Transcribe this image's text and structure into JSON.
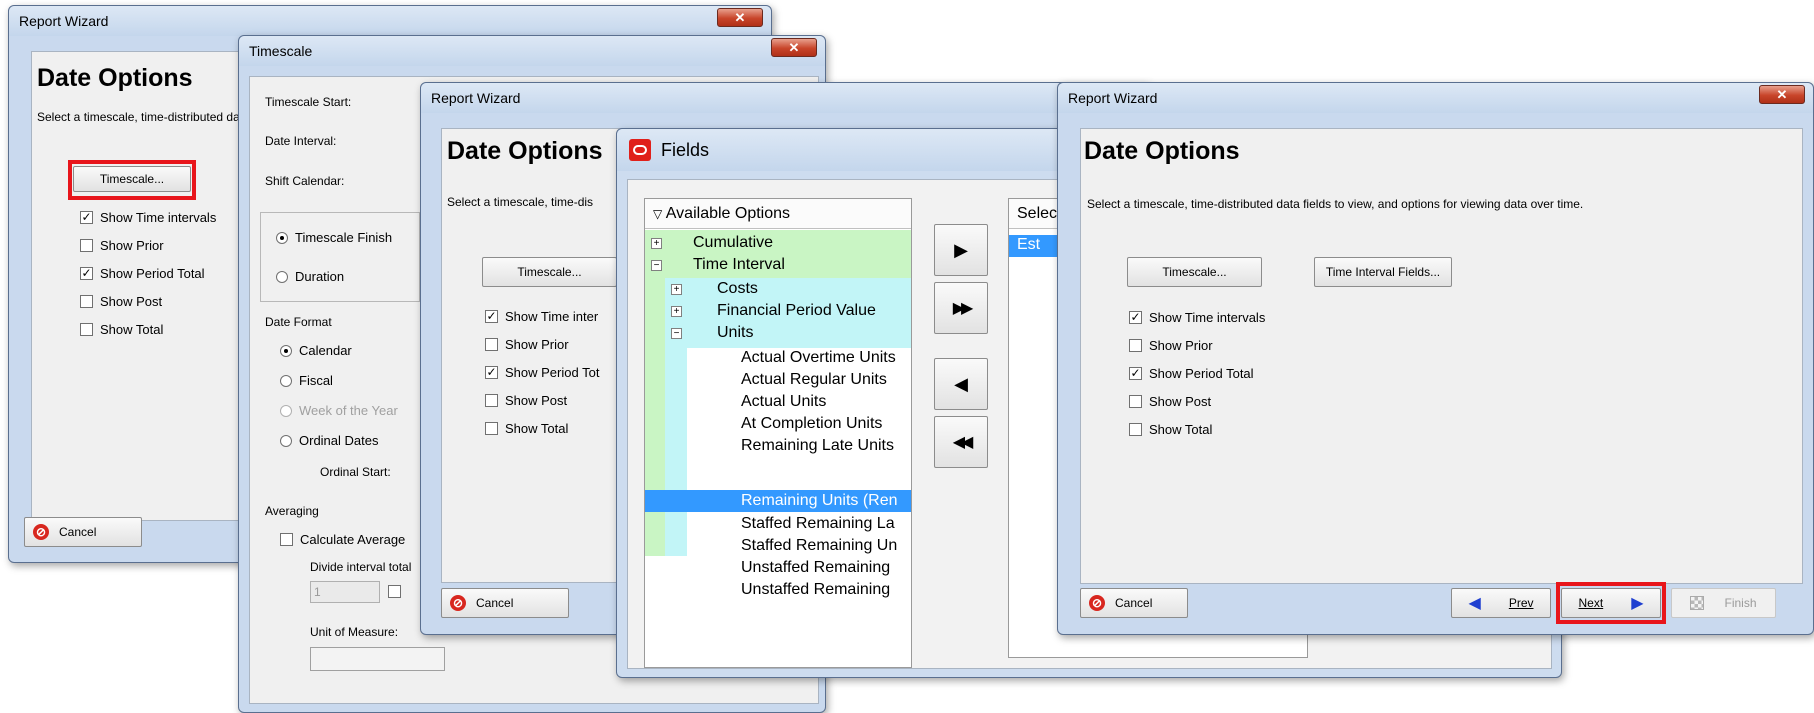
{
  "win1": {
    "title": "Report Wizard",
    "heading": "Date Options",
    "description": "Select a timescale, time-distributed data fields to view, and options for viewing data over time.",
    "timescale_btn": "Timescale...",
    "checkboxes": [
      {
        "label": "Show Time intervals",
        "checked": true
      },
      {
        "label": "Show Prior",
        "checked": false
      },
      {
        "label": "Show Period Total",
        "checked": true
      },
      {
        "label": "Show Post",
        "checked": false
      },
      {
        "label": "Show Total",
        "checked": false
      }
    ],
    "cancel": "Cancel"
  },
  "timescale": {
    "title": "Timescale",
    "start_label": "Timescale Start:",
    "interval_label": "Date Interval:",
    "shift_label": "Shift Calendar:",
    "finish_radio": "Timescale Finish",
    "duration_radio": "Duration",
    "date_format_label": "Date Format",
    "calendar": "Calendar",
    "fiscal": "Fiscal",
    "week": "Week of the Year",
    "ordinal": "Ordinal Dates",
    "ordinal_start": "Ordinal Start:",
    "averaging_label": "Averaging",
    "calc_avg": "Calculate Average",
    "divide_label": "Divide interval total",
    "divide_value": "1",
    "uom_label": "Unit of Measure:"
  },
  "win3": {
    "title": "Report Wizard",
    "heading": "Date Options",
    "description": "Select a timescale, time-dis",
    "timescale_btn": "Timescale...",
    "checkboxes": [
      {
        "label": "Show Time inter",
        "checked": true
      },
      {
        "label": "Show Prior",
        "checked": false
      },
      {
        "label": "Show Period Tot",
        "checked": true
      },
      {
        "label": "Show Post",
        "checked": false
      },
      {
        "label": "Show Total",
        "checked": false
      }
    ],
    "cancel": "Cancel"
  },
  "fields": {
    "title": "Fields",
    "available_header": "Available Options",
    "selected_header": "Selec",
    "selected_item": "Est",
    "tree": [
      {
        "label": "Cumulative",
        "level": 0,
        "expander": "+"
      },
      {
        "label": "Time Interval",
        "level": 0,
        "expander": "−"
      },
      {
        "label": "Costs",
        "level": 1,
        "expander": "+"
      },
      {
        "label": "Financial Period Value",
        "level": 1,
        "expander": "+"
      },
      {
        "label": "Units",
        "level": 1,
        "expander": "−"
      },
      {
        "label": "Actual Overtime Units",
        "level": 2
      },
      {
        "label": "Actual Regular Units",
        "level": 2
      },
      {
        "label": "Actual Units",
        "level": 2
      },
      {
        "label": "At Completion Units",
        "level": 2
      },
      {
        "label": "Remaining Late Units",
        "level": 2
      },
      {
        "label": "Remaining Units  (Ren",
        "level": 2,
        "selected": true
      },
      {
        "label": "Staffed Remaining La",
        "level": 2
      },
      {
        "label": "Staffed Remaining Un",
        "level": 2
      },
      {
        "label": "Unstaffed Remaining",
        "level": 2
      },
      {
        "label": "Unstaffed Remaining",
        "level": 2
      }
    ],
    "buttons": [
      "▶",
      "▶▶",
      "◀",
      "◀◀"
    ]
  },
  "win5": {
    "title": "Report Wizard",
    "heading": "Date Options",
    "description": "Select a timescale, time-distributed data fields to view, and options for viewing data over time.",
    "timescale_btn": "Timescale...",
    "interval_fields_btn": "Time Interval Fields...",
    "checkboxes": [
      {
        "label": "Show Time intervals",
        "checked": true
      },
      {
        "label": "Show Prior",
        "checked": false
      },
      {
        "label": "Show Period Total",
        "checked": true
      },
      {
        "label": "Show Post",
        "checked": false
      },
      {
        "label": "Show Total",
        "checked": false
      }
    ],
    "cancel": "Cancel",
    "prev": "Prev",
    "next": "Next",
    "finish": "Finish"
  },
  "colors": {
    "highlight": "#e8151b",
    "selection": "#3399ff",
    "tree_green": "#c9f5c4",
    "tree_cyan": "#c2f5f7"
  }
}
